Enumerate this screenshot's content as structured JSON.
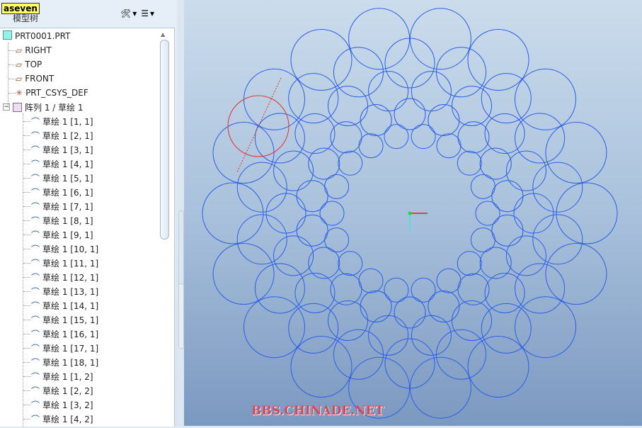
{
  "tooltip": "aseven",
  "panel": {
    "title": "模型树",
    "tools": [
      {
        "icon": "settings-tools-icon"
      },
      {
        "icon": "tree-columns-icon"
      }
    ]
  },
  "tree": {
    "root": "PRT0001.PRT",
    "features": [
      {
        "label": "RIGHT",
        "icon": "datum-plane-icon"
      },
      {
        "label": "TOP",
        "icon": "datum-plane-icon"
      },
      {
        "label": "FRONT",
        "icon": "datum-plane-icon"
      },
      {
        "label": "PRT_CSYS_DEF",
        "icon": "csys-icon"
      }
    ],
    "pattern": "阵列 1 / 草绘 1",
    "sketches": [
      "草绘 1 [1, 1]",
      "草绘 1 [2, 1]",
      "草绘 1 [3, 1]",
      "草绘 1 [4, 1]",
      "草绘 1 [5, 1]",
      "草绘 1 [6, 1]",
      "草绘 1 [7, 1]",
      "草绘 1 [8, 1]",
      "草绘 1 [9, 1]",
      "草绘 1 [10, 1]",
      "草绘 1 [11, 1]",
      "草绘 1 [12, 1]",
      "草绘 1 [13, 1]",
      "草绘 1 [14, 1]",
      "草绘 1 [15, 1]",
      "草绘 1 [16, 1]",
      "草绘 1 [17, 1]",
      "草绘 1 [18, 1]",
      "草绘 1 [1, 2]",
      "草绘 1 [2, 2]",
      "草绘 1 [3, 2]",
      "草绘 1 [4, 2]"
    ]
  },
  "viewport": {
    "watermark": "BBS.CHINADE.NET",
    "circle_color": "#2a5ee8",
    "selected_color": "#e03030"
  }
}
